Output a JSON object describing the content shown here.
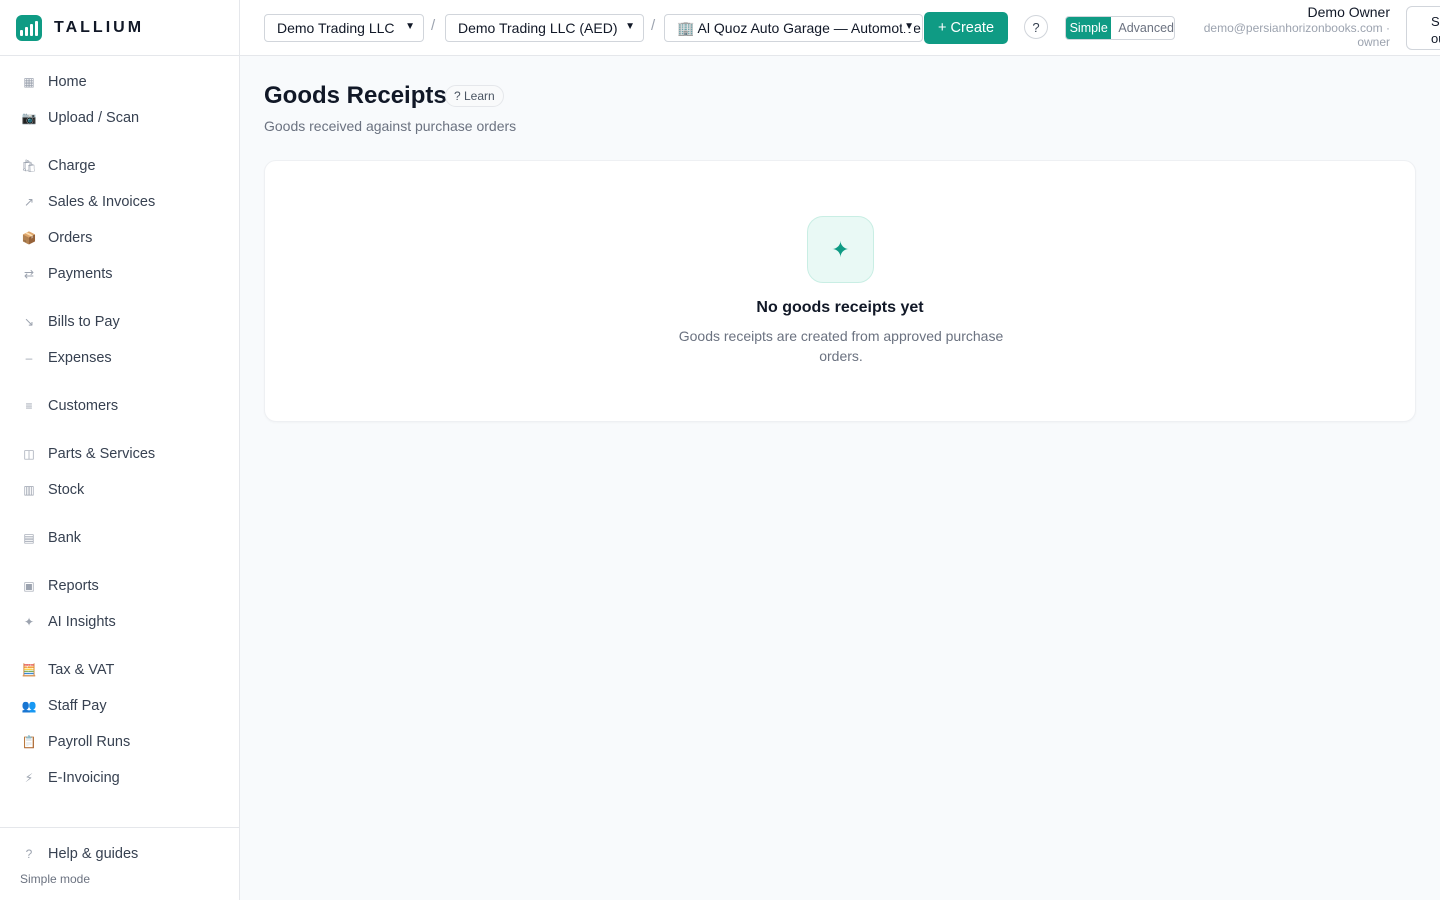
{
  "brand": {
    "name": "TALLIUM"
  },
  "sidebar": {
    "groups": [
      [
        {
          "label": "Home",
          "icon": "grid-icon"
        },
        {
          "label": "Upload / Scan",
          "icon": "camera-icon"
        }
      ],
      [
        {
          "label": "Charge",
          "icon": "shopping-bags-icon"
        },
        {
          "label": "Sales & Invoices",
          "icon": "arrow-up-right-icon"
        },
        {
          "label": "Orders",
          "icon": "package-icon"
        },
        {
          "label": "Payments",
          "icon": "swap-arrows-icon"
        }
      ],
      [
        {
          "label": "Bills to Pay",
          "icon": "arrow-down-right-icon"
        },
        {
          "label": "Expenses",
          "icon": "minus-icon"
        }
      ],
      [
        {
          "label": "Customers",
          "icon": "list-icon"
        }
      ],
      [
        {
          "label": "Parts & Services",
          "icon": "box-icon"
        },
        {
          "label": "Stock",
          "icon": "columns-icon"
        }
      ],
      [
        {
          "label": "Bank",
          "icon": "bank-icon"
        }
      ],
      [
        {
          "label": "Reports",
          "icon": "square-icon"
        },
        {
          "label": "AI Insights",
          "icon": "sparkle-icon"
        }
      ],
      [
        {
          "label": "Tax & VAT",
          "icon": "abacus-icon"
        },
        {
          "label": "Staff Pay",
          "icon": "people-icon"
        },
        {
          "label": "Payroll Runs",
          "icon": "clipboard-icon"
        },
        {
          "label": "E-Invoicing",
          "icon": "lightning-icon"
        }
      ]
    ],
    "footer": {
      "help_label": "Help & guides",
      "mode_label": "Simple mode"
    }
  },
  "topbar": {
    "company": "Demo Trading LLC",
    "ledger": "Demo Trading LLC (AED)",
    "branch": "🏢 Al Quoz Auto Garage — Automotive",
    "create_label": "+ Create",
    "help_label": "?",
    "mode_simple": "Simple",
    "mode_advanced": "Advanced",
    "user_name": "Demo Owner",
    "user_email": "demo@persianhorizonbooks.com ·",
    "user_role": "owner",
    "signout_label": "Sign out"
  },
  "page": {
    "title": "Goods Receipts",
    "learn_label": "? Learn",
    "subtitle": "Goods received against purchase orders",
    "empty_title": "No goods receipts yet",
    "empty_desc": "Goods receipts are created from approved purchase orders."
  },
  "colors": {
    "accent": "#0f9b84"
  }
}
